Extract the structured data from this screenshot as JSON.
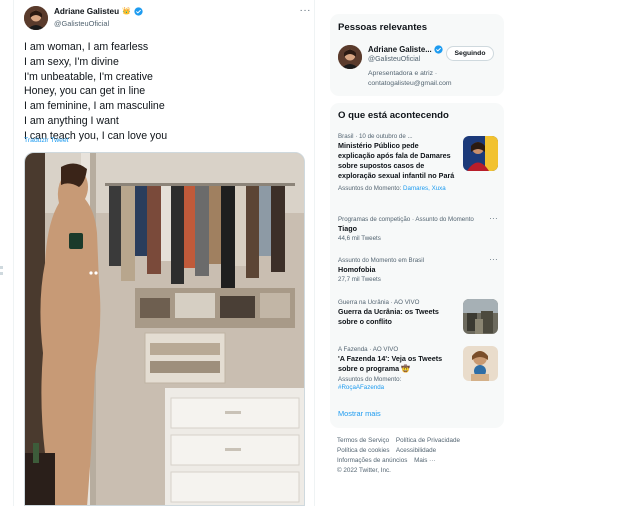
{
  "tweet": {
    "author_name": "Adriane Galisteu",
    "author_emoji": "👑",
    "author_handle": "@GalisteuOficial",
    "more_label": "···",
    "lines": [
      "I am woman, I am fearless",
      "I am sexy, I'm divine",
      "I'm unbeatable, I'm creative",
      "Honey, you can get in line",
      "I am feminine, I am masculine",
      "I am anything I want",
      "I can teach you, I can love you"
    ],
    "translate_label": "Traduzir Tweet",
    "media_alt": "photo"
  },
  "relevant_people": {
    "title": "Pessoas relevantes",
    "person": {
      "name": "Adriane Galiste...",
      "handle": "@GalisteuOficial",
      "follow_label": "Seguindo",
      "bio_line1": "Apresentadora e atriz ·",
      "bio_line2": "contatogalisteu@gmail.com"
    }
  },
  "trends": {
    "title": "O que está acontecendo",
    "items": [
      {
        "meta": "Brasil · 10 de outubro de ...",
        "title": "Ministério Público pede explicação após fala de Damares sobre supostos casos de exploração sexual infantil no Pará",
        "sub_label": "Assuntos do Momento:",
        "sub_links": "Damares, Xuxa"
      },
      {
        "meta": "Programas de competição · Assunto do Momento",
        "title": "Tiago",
        "count": "44,6 mil Tweets"
      },
      {
        "meta": "Assunto do Momento em Brasil",
        "title": "Homofobia",
        "count": "27,7 mil Tweets"
      },
      {
        "meta": "Guerra na Ucrânia · AO VIVO",
        "title": "Guerra da Ucrânia: os Tweets sobre o conflito"
      },
      {
        "meta": "A Fazenda · AO VIVO",
        "title": "'A Fazenda 14': Veja os Tweets sobre o programa 🤠",
        "sub_label": "Assuntos do Momento:",
        "sub_links": "#RoçaAFazenda"
      }
    ],
    "show_more": "Mostrar mais"
  },
  "footer": {
    "links": [
      "Termos de Serviço",
      "Política de Privacidade",
      "Política de cookies",
      "Acessibilidade",
      "Informações de anúncios",
      "Mais ···"
    ],
    "copyright": "© 2022 Twitter, Inc."
  },
  "colors": {
    "accent": "#1d9bf0",
    "text": "#0f1419",
    "muted": "#536471",
    "card_bg": "#f7f9f9"
  }
}
